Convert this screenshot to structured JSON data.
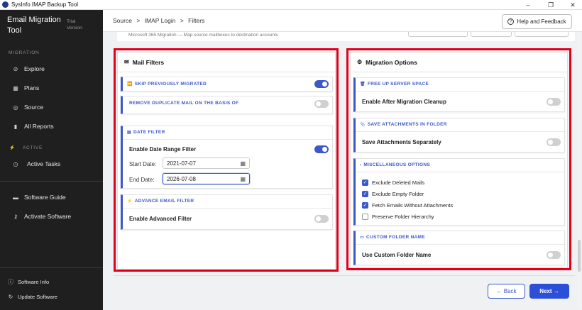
{
  "window": {
    "title": "SysInfo IMAP Backup Tool",
    "controls": [
      "–",
      "❐",
      "✕"
    ]
  },
  "sidebar": {
    "brand": "Email Migration Tool",
    "trial": "Trial Version",
    "section_migration": "MIGRATION",
    "explore": "Explore",
    "plans": "Plans",
    "source": "Source",
    "all_reports": "All Reports",
    "section_active": "ACTIVE",
    "active_tasks": "Active Tasks",
    "software_guide": "Software Guide",
    "activate_software": "Activate Software",
    "software_info": "Software Info",
    "update_software": "Update Software",
    "icons": {
      "explore": "compass-icon",
      "plans": "grid-icon",
      "source": "target-icon",
      "reports": "bar-chart-icon",
      "active": "bolt-icon",
      "tasks": "clock-icon",
      "guide": "book-icon",
      "activate": "key-icon",
      "info": "info-icon",
      "update": "refresh-icon"
    }
  },
  "header": {
    "breadcrumb": [
      "Source",
      ">",
      "IMAP Login",
      ">",
      "Filters"
    ],
    "help_label": "Help and Feedback",
    "subtitle": "Microsoft 365 Migration — Map source mailboxes to destination accounts"
  },
  "mail_filters": {
    "title": "Mail Filters",
    "skip_previously_migrated": {
      "label": "SKIP PREVIOUSLY MIGRATED",
      "enabled": true
    },
    "remove_duplicate": {
      "label": "REMOVE DUPLICATE MAIL ON THE BASIS OF",
      "enabled": false
    },
    "date_filter": {
      "label": "DATE FILTER",
      "enable_label": "Enable Date Range Filter",
      "enabled": true,
      "start_label": "Start Date:",
      "start_value": "2021-07-07",
      "end_label": "End Date:",
      "end_value": "2026-07-08"
    },
    "advance_email_filter": {
      "label": "ADVANCE EMAIL FILTER",
      "enable_label": "Enable Advanced Filter",
      "enabled": false
    }
  },
  "migration_options": {
    "title": "Migration Options",
    "free_up": {
      "label": "FREE UP SERVER SPACE",
      "row_label": "Enable After Migration Cleanup",
      "enabled": false
    },
    "save_attachments": {
      "label": "SAVE ATTACHMENTS IN FOLDER",
      "row_label": "Save Attachments Separately",
      "enabled": false
    },
    "misc": {
      "label": "MISCELLANEOUS OPTIONS",
      "items": [
        {
          "label": "Exclude Deleted Mails",
          "checked": true
        },
        {
          "label": "Exclude Empty Folder",
          "checked": true
        },
        {
          "label": "Fetch Emails Without Attachments",
          "checked": true
        },
        {
          "label": "Preserve Folder Hierarchy",
          "checked": false
        }
      ]
    },
    "custom_folder": {
      "label": "CUSTOM FOLDER NAME",
      "row_label": "Use Custom Folder Name",
      "enabled": false
    }
  },
  "footer": {
    "back_label": "← Back",
    "next_label": "Next →"
  },
  "colors": {
    "accent": "#3a58c9",
    "highlight": "#e0001b",
    "sidebar_bg": "#1f1f1f"
  }
}
